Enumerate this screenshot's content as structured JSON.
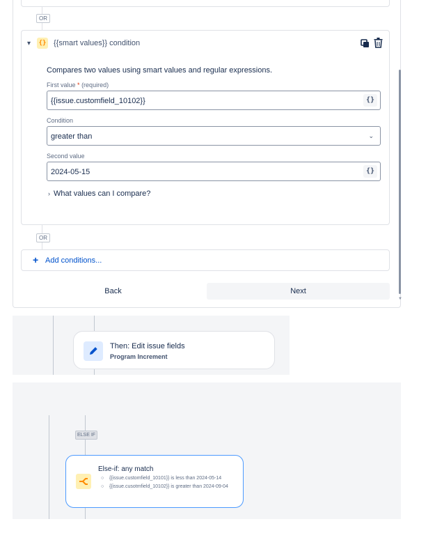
{
  "operators": {
    "or_top": "OR",
    "or_bottom": "OR"
  },
  "condition_card": {
    "title": "{{smart values}} condition",
    "badge": "{}",
    "description": "Compares two values using smart values and regular expressions.",
    "first_value": {
      "label": "First value",
      "required_mark": "*",
      "required_text": "(required)",
      "value": "{{issue.customfield_10102}}",
      "button": "{}"
    },
    "condition": {
      "label": "Condition",
      "value": "greater than"
    },
    "second_value": {
      "label": "Second value",
      "value": "2024-05-15",
      "button": "{}"
    },
    "help_link": "What values can I compare?"
  },
  "add_conditions": {
    "plus": "+",
    "label": "Add conditions..."
  },
  "footer": {
    "back": "Back",
    "next": "Next"
  },
  "then_node": {
    "title": "Then: Edit issue fields",
    "subtitle": "Program Increment"
  },
  "else_if_node": {
    "badge": "ELSE IF",
    "title": "Else-if: any match",
    "items": [
      "{{issue.customfield_10101}} is less than 2024-05-14",
      "{{issue.cusotmfield_10102}} is greater than 2024-09-04"
    ]
  },
  "icons": {
    "chevron": "chevron-down-icon",
    "copy": "copy-icon",
    "delete": "trash-icon",
    "dropdown": "chevron-down-icon",
    "help_caret": "chevron-right-icon",
    "pencil": "pencil-icon",
    "branch": "branch-icon"
  },
  "colors": {
    "link": "#0052cc",
    "smart_value_badge_bg": "#fff0b3",
    "smart_value_badge_fg": "#ff8b00",
    "pencil_bg": "#deebff",
    "selected_border": "#4c9aff",
    "canvas_bg": "#f4f5f7"
  }
}
